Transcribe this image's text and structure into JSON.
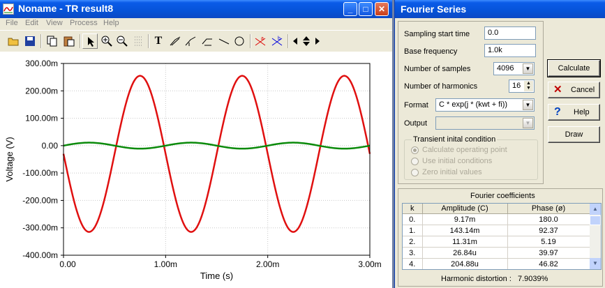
{
  "left_window": {
    "title": "Noname - TR result8",
    "menu": [
      "File",
      "Edit",
      "View",
      "Process",
      "Help"
    ],
    "toolbar_icons": [
      "open-icon",
      "save-icon",
      "copy-icon",
      "paste-icon",
      "pointer-icon",
      "zoom-in-icon",
      "zoom-out-icon",
      "grid-icon",
      "text-icon",
      "cursor-a-icon",
      "cursor-b-icon",
      "marker-icon",
      "line-icon",
      "circle-icon",
      "marker-a-icon",
      "marker-b-icon",
      "arrow-left-icon",
      "arrow-updown-icon",
      "arrow-right-icon"
    ]
  },
  "chart_data": {
    "type": "line",
    "xlabel": "Time (s)",
    "ylabel": "Voltage (V)",
    "xlim": [
      0,
      3.0
    ],
    "ylim": [
      -400,
      300
    ],
    "x_ticks": [
      "0.00",
      "1.00m",
      "2.00m",
      "3.00m"
    ],
    "y_ticks": [
      "300.00m",
      "200.00m",
      "100.00m",
      "0.00",
      "-100.00m",
      "-200.00m",
      "-300.00m",
      "-400.00m"
    ],
    "grid": true,
    "series": [
      {
        "color": "#e01010",
        "amplitude": 285,
        "offset": -30,
        "period": 1.0,
        "phase": "negative-sine"
      },
      {
        "color": "#0a8a0a",
        "amplitude": 11,
        "offset": 0,
        "period": 1.0,
        "phase": "positive-sine"
      }
    ]
  },
  "dialog": {
    "title": "Fourier Series",
    "fields": {
      "sampling_start_label": "Sampling start time",
      "sampling_start_value": "0.0",
      "base_freq_label": "Base frequency",
      "base_freq_value": "1.0k",
      "num_samples_label": "Number of samples",
      "num_samples_value": "4096",
      "num_harmonics_label": "Number of harmonics",
      "num_harmonics_value": "16",
      "format_label": "Format",
      "format_value": "C * exp(j * (kwt + fi))",
      "output_label": "Output",
      "output_value": ""
    },
    "transient": {
      "title": "Transient inital condition",
      "options": [
        "Calculate operating point",
        "Use initial conditions",
        "Zero initial values"
      ]
    },
    "buttons": {
      "calculate": "Calculate",
      "cancel": "Cancel",
      "help": "Help",
      "draw": "Draw"
    },
    "coefficients": {
      "title": "Fourier coefficients",
      "columns": [
        "k",
        "Amplitude (C)",
        "Phase (ø)"
      ],
      "rows": [
        [
          "0.",
          "9.17m",
          "180.0"
        ],
        [
          "1.",
          "143.14m",
          "92.37"
        ],
        [
          "2.",
          "11.31m",
          "5.19"
        ],
        [
          "3.",
          "26.84u",
          "39.97"
        ],
        [
          "4.",
          "204.88u",
          "46.82"
        ]
      ]
    },
    "distortion_label": "Harmonic distortion :",
    "distortion_value": "7.9039%"
  }
}
